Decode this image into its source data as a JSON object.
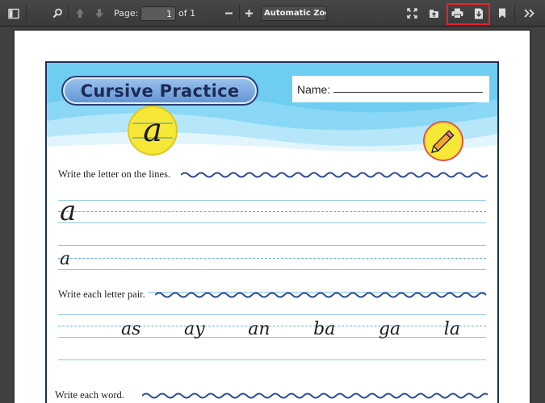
{
  "toolbar": {
    "page_label": "Page:",
    "page_value": "1",
    "page_count": "of 1",
    "zoom_value": "Automatic Zoom",
    "zoom_caret": "÷",
    "icons": [
      "sidebar-toggle-icon",
      "search-icon",
      "arrow-up-icon",
      "arrow-down-icon",
      "minus-icon",
      "plus-icon",
      "fullscreen-icon",
      "open-file-icon",
      "print-icon",
      "download-icon",
      "bookmark-icon",
      "tools-chevron-icon"
    ],
    "highlight_color": "#e8222c"
  },
  "worksheet": {
    "title": "Cursive Practice",
    "name_label": "Name:",
    "badge_letter": "a",
    "instructions": {
      "letters": "Write the letter on the lines.",
      "pairs": "Write each letter pair.",
      "words": "Write each word."
    },
    "practice_upper": "a",
    "practice_lower": "a",
    "pairs": [
      "as",
      "ay",
      "an",
      "ba",
      "ga",
      "la"
    ],
    "colors": {
      "banner": "#6fcdf1",
      "wave": "#2f4a9a",
      "guideline": "#8fc7e8",
      "badge": "#f7e736"
    }
  }
}
